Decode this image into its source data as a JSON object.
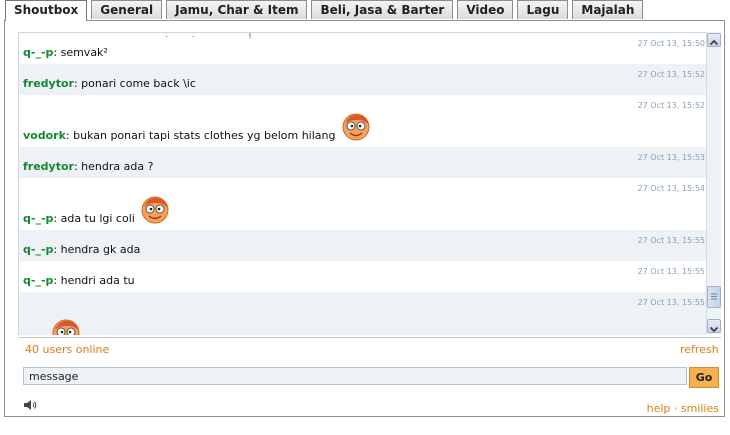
{
  "tabs": [
    {
      "label": "Shoutbox",
      "active": true
    },
    {
      "label": "General"
    },
    {
      "label": "Jamu, Char & Item"
    },
    {
      "label": "Beli, Jasa & Barter"
    },
    {
      "label": "Video"
    },
    {
      "label": "Lagu"
    },
    {
      "label": "Majalah"
    }
  ],
  "chat": {
    "cut_line": "' ' ' . ' ' . ' ' ' ' ' '( ' ' ' ' ' ' '' ' ' ' ' '",
    "messages": [
      {
        "timestamp": "27 Oct 13, 15:50",
        "user": "q-_-p",
        "text": ": semvak²",
        "smiley": false
      },
      {
        "timestamp": "27 Oct 13, 15:52",
        "user": "fredytor",
        "text": ": ponari come back \\ic",
        "smiley": false
      },
      {
        "timestamp": "27 Oct 13, 15:52",
        "user": "vodork",
        "text": ": bukan ponari tapi stats clothes yg belom hilang",
        "smiley": true
      },
      {
        "timestamp": "27 Oct 13, 15:53",
        "user": "fredytor",
        "text": ": hendra ada ?",
        "smiley": false
      },
      {
        "timestamp": "27 Oct 13, 15:54",
        "user": "q-_-p",
        "text": ": ada tu lgi coli",
        "smiley": true
      },
      {
        "timestamp": "27 Oct 13, 15:55",
        "user": "q-_-p",
        "text": ": hendra gk ada",
        "smiley": false
      },
      {
        "timestamp": "27 Oct 13, 15:55",
        "user": "q-_-p",
        "text": ": hendri ada tu",
        "smiley": false
      },
      {
        "timestamp": "27 Oct 13, 15:55",
        "user": "",
        "text": "",
        "smiley": true
      }
    ]
  },
  "status": {
    "online": "40 users online",
    "refresh": "refresh"
  },
  "input": {
    "value": "message"
  },
  "go_label": "Go",
  "footer": {
    "help": "help",
    "dot": " · ",
    "smilies": "smilies"
  },
  "icons": {
    "speaker": "speaker-icon",
    "smiley": "smiley-face-icon",
    "scroll_up": "arrow-up-icon",
    "scroll_down": "arrow-down-icon"
  },
  "colors": {
    "username": "#138a2e",
    "link": "#e07b1a",
    "timestamp": "#8aa0b8",
    "row_alt": "#eef1f5",
    "go_button": "#f7b04f"
  }
}
